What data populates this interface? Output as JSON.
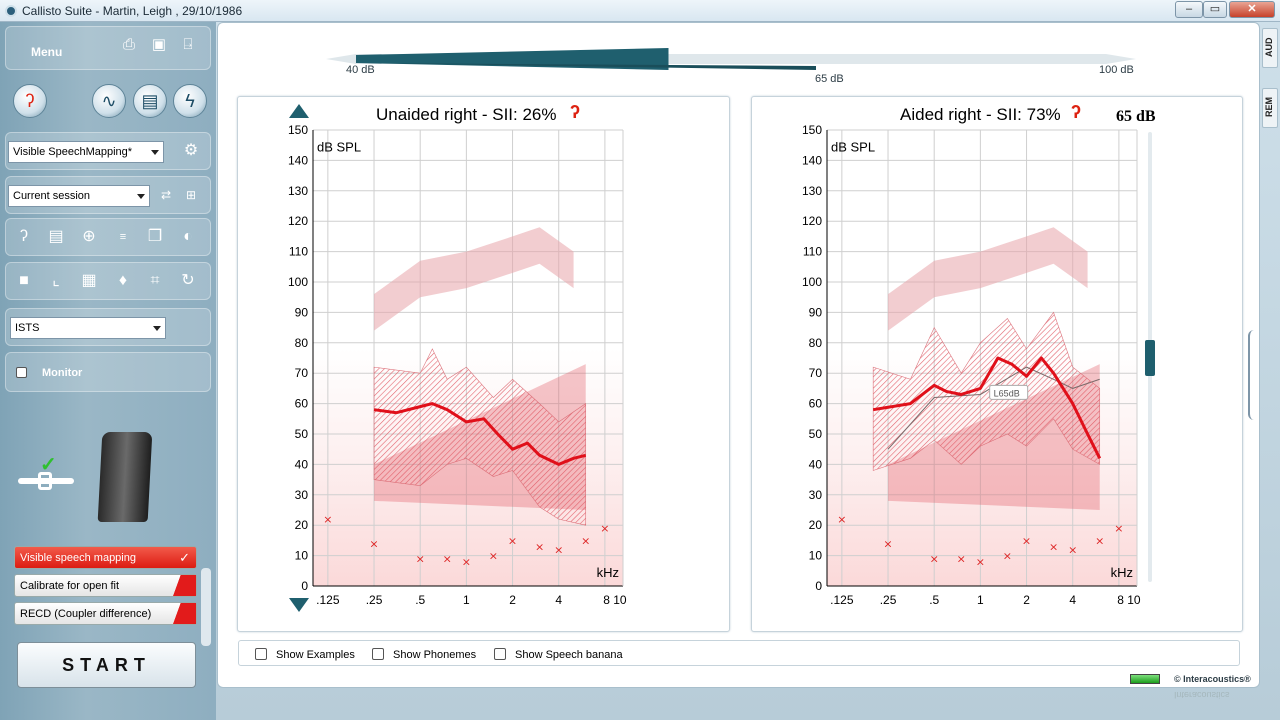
{
  "window": {
    "title": "Callisto Suite - Martin, Leigh , 29/10/1986",
    "min": "–",
    "max": "▭",
    "close": "✕"
  },
  "sidebar": {
    "menu_label": "Menu",
    "mode_select": "Visible SpeechMapping*",
    "session_select": "Current session",
    "signal_select": "ISTS",
    "monitor_label": "Monitor",
    "steps": [
      "Visible speech mapping",
      "Calibrate for open fit",
      "RECD (Coupler difference)"
    ],
    "check_mark": "✓",
    "start_label": "START"
  },
  "level_slider": {
    "min_label": "40 dB",
    "mid_label": "65 dB",
    "max_label": "100 dB",
    "value_db": 65,
    "range": [
      40,
      100
    ]
  },
  "side_tabs": [
    "AUD",
    "REM"
  ],
  "big_level": "65 dB",
  "footer": {
    "brand": "© Interacoustics®",
    "reflection": "Interacoustics"
  },
  "options": [
    "Show Examples",
    "Show Phonemes",
    "Show Speech banana"
  ],
  "colors": {
    "curve": "#e0101a",
    "band": "#e8505a",
    "accent": "#1f5f6e"
  },
  "chart_data": [
    {
      "type": "line",
      "title": "Unaided right - SII: 26%",
      "ylabel": "dB SPL",
      "xlabel": "kHz",
      "ylim": [
        0,
        150
      ],
      "yticks": [
        0,
        10,
        20,
        30,
        40,
        50,
        60,
        70,
        80,
        90,
        100,
        110,
        120,
        130,
        140,
        150
      ],
      "xticks": [
        ".125",
        ".25",
        ".5",
        "1",
        "2",
        "4",
        "8 10"
      ],
      "x_freq_khz": [
        0.125,
        0.25,
        0.5,
        1,
        2,
        4,
        8
      ],
      "series": [
        {
          "x": [
            0.25,
            0.35,
            0.5,
            0.6,
            0.75,
            1,
            1.3,
            1.6,
            2,
            2.5,
            3,
            4,
            5,
            6
          ],
          "y": [
            58,
            57,
            59,
            60,
            58,
            54,
            55,
            50,
            45,
            47,
            43,
            40,
            42,
            43
          ]
        }
      ],
      "band_upper": {
        "x": [
          0.25,
          0.5,
          0.6,
          0.75,
          1,
          1.5,
          2,
          3,
          4,
          6
        ],
        "y": [
          72,
          70,
          78,
          68,
          72,
          62,
          68,
          60,
          54,
          60
        ]
      },
      "band_lower": {
        "x": [
          0.25,
          0.5,
          0.75,
          1,
          1.5,
          2,
          3,
          4,
          6
        ],
        "y": [
          35,
          33,
          40,
          42,
          36,
          38,
          26,
          22,
          20
        ]
      },
      "thresholds": {
        "x": [
          0.125,
          0.25,
          0.5,
          0.75,
          1,
          1.5,
          2,
          3,
          4,
          6,
          8
        ],
        "y": [
          22,
          14,
          9,
          9,
          8,
          10,
          15,
          13,
          12,
          15,
          19
        ]
      },
      "ucl": {
        "x": [
          0.25,
          0.5,
          1,
          2,
          3,
          5
        ],
        "y": [
          96,
          107,
          110,
          115,
          118,
          110
        ]
      },
      "gap_line": {
        "x": [
          0.25,
          6
        ],
        "y": [
          40,
          73
        ]
      }
    },
    {
      "type": "line",
      "title": "Aided right - SII: 73%",
      "ylabel": "dB SPL",
      "xlabel": "kHz",
      "ylim": [
        0,
        150
      ],
      "yticks": [
        0,
        10,
        20,
        30,
        40,
        50,
        60,
        70,
        80,
        90,
        100,
        110,
        120,
        130,
        140,
        150
      ],
      "xticks": [
        ".125",
        ".25",
        ".5",
        "1",
        "2",
        "4",
        "8 10"
      ],
      "x_freq_khz": [
        0.125,
        0.25,
        0.5,
        1,
        2,
        4,
        8
      ],
      "annotation": "L65dB",
      "series": [
        {
          "x": [
            0.2,
            0.35,
            0.5,
            0.6,
            0.75,
            1,
            1.3,
            1.6,
            2,
            2.5,
            3,
            4,
            5,
            6
          ],
          "y": [
            58,
            60,
            66,
            64,
            63,
            65,
            75,
            73,
            69,
            75,
            70,
            60,
            50,
            42
          ]
        }
      ],
      "target": {
        "x": [
          0.25,
          0.5,
          1,
          2,
          3,
          4,
          6
        ],
        "y": [
          45,
          62,
          63,
          72,
          68,
          65,
          68
        ]
      },
      "band_upper": {
        "x": [
          0.2,
          0.35,
          0.5,
          0.75,
          1,
          1.5,
          2,
          3,
          4,
          6
        ],
        "y": [
          72,
          68,
          85,
          70,
          80,
          88,
          78,
          90,
          72,
          65
        ]
      },
      "band_lower": {
        "x": [
          0.2,
          0.35,
          0.5,
          0.75,
          1,
          1.5,
          2,
          3,
          4,
          6
        ],
        "y": [
          38,
          42,
          48,
          40,
          46,
          50,
          46,
          55,
          45,
          40
        ]
      },
      "thresholds": {
        "x": [
          0.125,
          0.25,
          0.5,
          0.75,
          1,
          1.5,
          2,
          3,
          4,
          6,
          8
        ],
        "y": [
          22,
          14,
          9,
          9,
          8,
          10,
          15,
          13,
          12,
          15,
          19
        ]
      },
      "ucl": {
        "x": [
          0.25,
          0.5,
          1,
          2,
          3,
          5
        ],
        "y": [
          96,
          107,
          110,
          115,
          118,
          110
        ]
      },
      "gap_line": {
        "x": [
          0.25,
          6
        ],
        "y": [
          40,
          73
        ]
      }
    }
  ]
}
